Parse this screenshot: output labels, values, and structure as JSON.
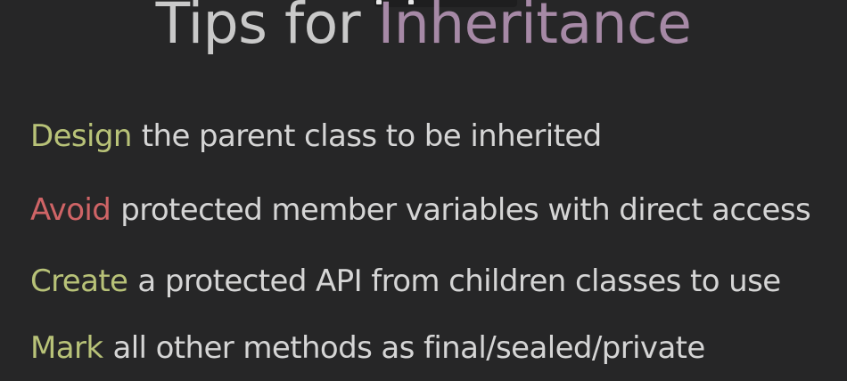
{
  "title": {
    "prefix": "Tips for",
    "highlight": "Inheritance"
  },
  "tips": [
    {
      "keyword": "Design",
      "rest": "the parent class to be inherited",
      "keyword_color": "#b8c278"
    },
    {
      "keyword": "Avoid",
      "rest": "protected member variables with direct access",
      "keyword_color": "#cf6466"
    },
    {
      "keyword": "Create",
      "rest": "a protected API from children classes to use",
      "keyword_color": "#b8c278"
    },
    {
      "keyword": "Mark",
      "rest": "all other methods as final/sealed/private",
      "keyword_color": "#b8c278"
    }
  ],
  "colors": {
    "background": "#262627",
    "text": "#d5d5d5",
    "title_accent": "#a689a6"
  }
}
